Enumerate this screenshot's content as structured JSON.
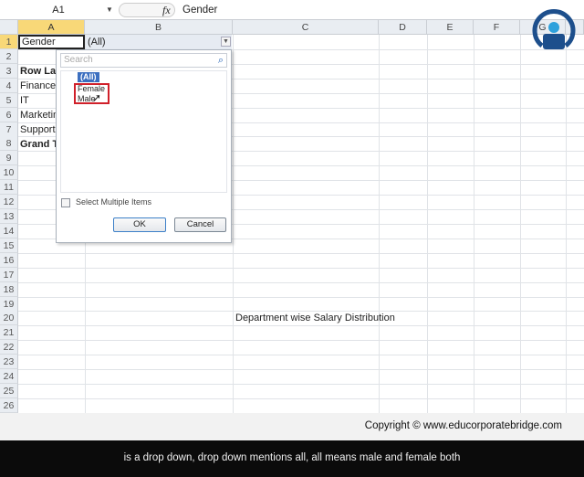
{
  "formula_bar": {
    "name_box": "A1",
    "fx": "fx",
    "value": "Gender"
  },
  "columns": [
    "A",
    "B",
    "C",
    "D",
    "E",
    "F",
    "G"
  ],
  "rows": [
    "1",
    "2",
    "3",
    "4",
    "5",
    "6",
    "7",
    "8",
    "9",
    "10",
    "11",
    "12",
    "13",
    "14",
    "15",
    "16",
    "17",
    "18",
    "19",
    "20",
    "21",
    "22",
    "23",
    "24",
    "25",
    "26"
  ],
  "cells": {
    "a1": "Gender",
    "b1": "(All)",
    "a3": "Row Labels",
    "a4": "Finance",
    "a5": "IT",
    "a6": "Marketing",
    "a7": "Support",
    "a8": "Grand Total",
    "c20": "Department wise Salary Distribution"
  },
  "filter_dropdown": {
    "search_placeholder": "Search",
    "items": [
      "(All)",
      "Female",
      "Male"
    ],
    "select_multiple_label": "Select Multiple Items",
    "ok_label": "OK",
    "cancel_label": "Cancel"
  },
  "footer": {
    "copyright": "Copyright © www.educorporatebridge.com"
  },
  "caption": "is a drop down, drop down mentions all, all means male and female both"
}
